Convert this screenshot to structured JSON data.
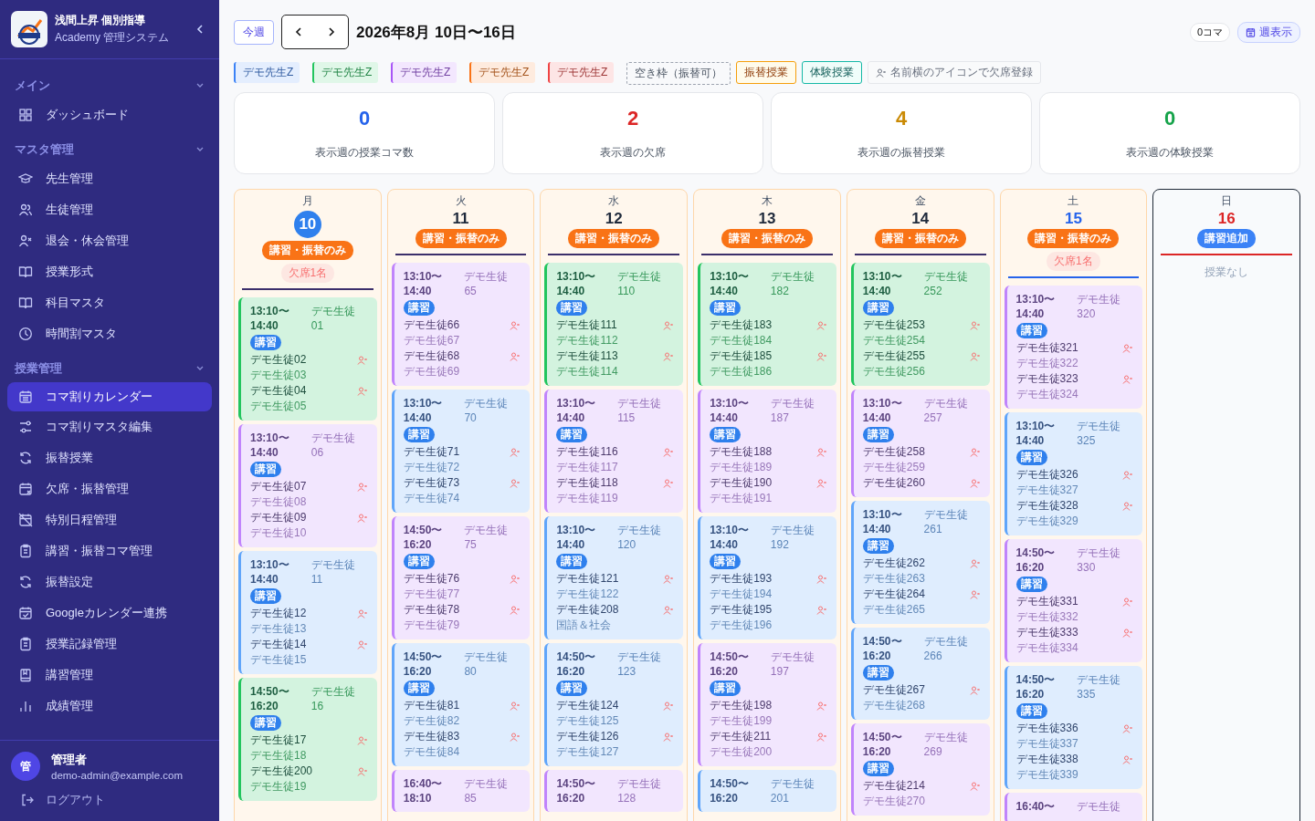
{
  "sidebar": {
    "brand": {
      "title": "浅間上昇 個別指導",
      "subtitle": "Academy 管理システム"
    },
    "sections": [
      {
        "title": "メイン",
        "expanded": true,
        "items": [
          {
            "label": "ダッシュボード",
            "selected": false
          }
        ]
      },
      {
        "title": "マスタ管理",
        "expanded": true,
        "items": [
          {
            "label": "先生管理",
            "selected": false
          },
          {
            "label": "生徒管理",
            "selected": false
          },
          {
            "label": "退会・休会管理",
            "selected": false
          },
          {
            "label": "授業形式",
            "selected": false
          },
          {
            "label": "科目マスタ",
            "selected": false
          },
          {
            "label": "時間割マスタ",
            "selected": false
          }
        ]
      },
      {
        "title": "授業管理",
        "expanded": true,
        "items": [
          {
            "label": "コマ割りカレンダー",
            "selected": true
          },
          {
            "label": "コマ割りマスタ編集",
            "selected": false
          },
          {
            "label": "振替授業",
            "selected": false
          },
          {
            "label": "欠席・振替管理",
            "selected": false
          },
          {
            "label": "特別日程管理",
            "selected": false
          },
          {
            "label": "講習・振替コマ管理",
            "selected": false
          },
          {
            "label": "振替設定",
            "selected": false
          },
          {
            "label": "Googleカレンダー連携",
            "selected": false
          },
          {
            "label": "授業記録管理",
            "selected": false
          },
          {
            "label": "講習管理",
            "selected": false
          },
          {
            "label": "成績管理",
            "selected": false
          }
        ]
      }
    ],
    "user": {
      "avatar": "管",
      "name": "管理者",
      "email": "demo-admin@example.com"
    },
    "logout": "ログアウト"
  },
  "toolbar": {
    "today_button": "今週",
    "title": "2026年8月 10日〜16日",
    "count": "0コマ",
    "view_button": "週表示"
  },
  "legend": [
    {
      "kind": "teacher",
      "label": "デモ先生Z",
      "color": "#3b82f6"
    },
    {
      "kind": "teacher",
      "label": "デモ先生Z",
      "color": "#22c55e"
    },
    {
      "kind": "teacher",
      "label": "デモ先生Z",
      "color": "#a855f7"
    },
    {
      "kind": "teacher",
      "label": "デモ先生Z",
      "color": "#f97316"
    },
    {
      "kind": "teacher",
      "label": "デモ先生Z",
      "color": "#ef4444"
    },
    {
      "kind": "empty",
      "label": "空き枠（振替可）"
    },
    {
      "kind": "transfer",
      "label": "振替授業"
    },
    {
      "kind": "trial",
      "label": "体験授業"
    },
    {
      "kind": "hint",
      "label": "名前横のアイコンで欠席登録"
    }
  ],
  "stats": [
    {
      "value": "0",
      "label": "表示週の授業コマ数",
      "color": "#2563eb"
    },
    {
      "value": "2",
      "label": "表示週の欠席",
      "color": "#dc2626"
    },
    {
      "value": "4",
      "label": "表示週の振替授業",
      "color": "#ca8a04"
    },
    {
      "value": "0",
      "label": "表示週の体験授業",
      "color": "#16a34a"
    }
  ],
  "days": [
    {
      "weekday": "月",
      "date": "10",
      "kind": "weekday",
      "today": true,
      "selected": false,
      "badge": {
        "kind": "restricted",
        "label": "講習・振替のみ"
      },
      "absence": "欠席1名",
      "lessons": [
        {
          "color": "#22c55e",
          "start": "13:10〜",
          "end": "14:40",
          "teacher": "デモ生徒01",
          "tag": "講習",
          "students": [
            {
              "name": "デモ生徒02",
              "kind": "main"
            },
            {
              "name": "デモ生徒03",
              "kind": "sub"
            },
            {
              "name": "デモ生徒04",
              "kind": "main"
            },
            {
              "name": "デモ生徒05",
              "kind": "sub"
            }
          ]
        },
        {
          "color": "#c084fc",
          "start": "13:10〜",
          "end": "14:40",
          "teacher": "デモ生徒06",
          "tag": "講習",
          "students": [
            {
              "name": "デモ生徒07",
              "kind": "main"
            },
            {
              "name": "デモ生徒08",
              "kind": "sub"
            },
            {
              "name": "デモ生徒09",
              "kind": "main"
            },
            {
              "name": "デモ生徒10",
              "kind": "sub"
            }
          ]
        },
        {
          "color": "#60a5fa",
          "start": "13:10〜",
          "end": "14:40",
          "teacher": "デモ生徒11",
          "tag": "講習",
          "students": [
            {
              "name": "デモ生徒12",
              "kind": "main"
            },
            {
              "name": "デモ生徒13",
              "kind": "sub"
            },
            {
              "name": "デモ生徒14",
              "kind": "main"
            },
            {
              "name": "デモ生徒15",
              "kind": "sub"
            }
          ]
        },
        {
          "color": "#22c55e",
          "start": "14:50〜",
          "end": "16:20",
          "teacher": "デモ生徒16",
          "tag": "講習",
          "students": [
            {
              "name": "デモ生徒17",
              "kind": "main"
            },
            {
              "name": "デモ生徒18",
              "kind": "sub"
            },
            {
              "name": "デモ生徒200",
              "kind": "main"
            },
            {
              "name": "デモ生徒19",
              "kind": "sub"
            }
          ]
        }
      ]
    },
    {
      "weekday": "火",
      "date": "11",
      "kind": "weekday",
      "today": false,
      "selected": false,
      "badge": {
        "kind": "restricted",
        "label": "講習・振替のみ"
      },
      "lessons": [
        {
          "color": "#c084fc",
          "start": "13:10〜",
          "end": "14:40",
          "teacher": "デモ生徒65",
          "tag": "講習",
          "students": [
            {
              "name": "デモ生徒66",
              "kind": "main"
            },
            {
              "name": "デモ生徒67",
              "kind": "sub"
            },
            {
              "name": "デモ生徒68",
              "kind": "main"
            },
            {
              "name": "デモ生徒69",
              "kind": "sub"
            }
          ]
        },
        {
          "color": "#60a5fa",
          "start": "13:10〜",
          "end": "14:40",
          "teacher": "デモ生徒70",
          "tag": "講習",
          "students": [
            {
              "name": "デモ生徒71",
              "kind": "main"
            },
            {
              "name": "デモ生徒72",
              "kind": "sub"
            },
            {
              "name": "デモ生徒73",
              "kind": "main"
            },
            {
              "name": "デモ生徒74",
              "kind": "sub"
            }
          ]
        },
        {
          "color": "#c084fc",
          "start": "14:50〜",
          "end": "16:20",
          "teacher": "デモ生徒75",
          "tag": "講習",
          "students": [
            {
              "name": "デモ生徒76",
              "kind": "main"
            },
            {
              "name": "デモ生徒77",
              "kind": "sub"
            },
            {
              "name": "デモ生徒78",
              "kind": "main"
            },
            {
              "name": "デモ生徒79",
              "kind": "sub"
            }
          ]
        },
        {
          "color": "#60a5fa",
          "start": "14:50〜",
          "end": "16:20",
          "teacher": "デモ生徒80",
          "tag": "講習",
          "students": [
            {
              "name": "デモ生徒81",
              "kind": "main"
            },
            {
              "name": "デモ生徒82",
              "kind": "sub"
            },
            {
              "name": "デモ生徒83",
              "kind": "main"
            },
            {
              "name": "デモ生徒84",
              "kind": "sub"
            }
          ]
        },
        {
          "color": "#c084fc",
          "start": "16:40〜",
          "end": "18:10",
          "teacher": "デモ生徒85"
        }
      ]
    },
    {
      "weekday": "水",
      "date": "12",
      "kind": "weekday",
      "today": false,
      "selected": false,
      "badge": {
        "kind": "restricted",
        "label": "講習・振替のみ"
      },
      "lessons": [
        {
          "color": "#22c55e",
          "start": "13:10〜",
          "end": "14:40",
          "teacher": "デモ生徒110",
          "tag": "講習",
          "students": [
            {
              "name": "デモ生徒111",
              "kind": "main"
            },
            {
              "name": "デモ生徒112",
              "kind": "sub"
            },
            {
              "name": "デモ生徒113",
              "kind": "main"
            },
            {
              "name": "デモ生徒114",
              "kind": "sub"
            }
          ]
        },
        {
          "color": "#c084fc",
          "start": "13:10〜",
          "end": "14:40",
          "teacher": "デモ生徒115",
          "tag": "講習",
          "students": [
            {
              "name": "デモ生徒116",
              "kind": "main"
            },
            {
              "name": "デモ生徒117",
              "kind": "sub"
            },
            {
              "name": "デモ生徒118",
              "kind": "main"
            },
            {
              "name": "デモ生徒119",
              "kind": "sub"
            }
          ]
        },
        {
          "color": "#60a5fa",
          "start": "13:10〜",
          "end": "14:40",
          "teacher": "デモ生徒120",
          "tag": "講習",
          "students": [
            {
              "name": "デモ生徒121",
              "kind": "main"
            },
            {
              "name": "デモ生徒122",
              "kind": "sub"
            },
            {
              "name": "デモ生徒208",
              "kind": "main"
            },
            {
              "name": "国語＆社会",
              "kind": "sub"
            }
          ]
        },
        {
          "color": "#60a5fa",
          "start": "14:50〜",
          "end": "16:20",
          "teacher": "デモ生徒123",
          "tag": "講習",
          "students": [
            {
              "name": "デモ生徒124",
              "kind": "main"
            },
            {
              "name": "デモ生徒125",
              "kind": "sub"
            },
            {
              "name": "デモ生徒126",
              "kind": "main"
            },
            {
              "name": "デモ生徒127",
              "kind": "sub"
            }
          ]
        },
        {
          "color": "#c084fc",
          "start": "14:50〜",
          "end": "16:20",
          "teacher": "デモ生徒128"
        }
      ]
    },
    {
      "weekday": "木",
      "date": "13",
      "kind": "weekday",
      "today": false,
      "selected": false,
      "badge": {
        "kind": "restricted",
        "label": "講習・振替のみ"
      },
      "lessons": [
        {
          "color": "#22c55e",
          "start": "13:10〜",
          "end": "14:40",
          "teacher": "デモ生徒182",
          "tag": "講習",
          "students": [
            {
              "name": "デモ生徒183",
              "kind": "main"
            },
            {
              "name": "デモ生徒184",
              "kind": "sub"
            },
            {
              "name": "デモ生徒185",
              "kind": "main"
            },
            {
              "name": "デモ生徒186",
              "kind": "sub"
            }
          ]
        },
        {
          "color": "#c084fc",
          "start": "13:10〜",
          "end": "14:40",
          "teacher": "デモ生徒187",
          "tag": "講習",
          "students": [
            {
              "name": "デモ生徒188",
              "kind": "main"
            },
            {
              "name": "デモ生徒189",
              "kind": "sub"
            },
            {
              "name": "デモ生徒190",
              "kind": "main"
            },
            {
              "name": "デモ生徒191",
              "kind": "sub"
            }
          ]
        },
        {
          "color": "#60a5fa",
          "start": "13:10〜",
          "end": "14:40",
          "teacher": "デモ生徒192",
          "tag": "講習",
          "students": [
            {
              "name": "デモ生徒193",
              "kind": "main"
            },
            {
              "name": "デモ生徒194",
              "kind": "sub"
            },
            {
              "name": "デモ生徒195",
              "kind": "main"
            },
            {
              "name": "デモ生徒196",
              "kind": "sub"
            }
          ]
        },
        {
          "color": "#c084fc",
          "start": "14:50〜",
          "end": "16:20",
          "teacher": "デモ生徒197",
          "tag": "講習",
          "students": [
            {
              "name": "デモ生徒198",
              "kind": "main"
            },
            {
              "name": "デモ生徒199",
              "kind": "sub"
            },
            {
              "name": "デモ生徒211",
              "kind": "main"
            },
            {
              "name": "デモ生徒200",
              "kind": "sub"
            }
          ]
        },
        {
          "color": "#60a5fa",
          "start": "14:50〜",
          "end": "16:20",
          "teacher": "デモ生徒201"
        }
      ]
    },
    {
      "weekday": "金",
      "date": "14",
      "kind": "weekday",
      "today": false,
      "selected": false,
      "badge": {
        "kind": "restricted",
        "label": "講習・振替のみ"
      },
      "lessons": [
        {
          "color": "#22c55e",
          "start": "13:10〜",
          "end": "14:40",
          "teacher": "デモ生徒252",
          "tag": "講習",
          "students": [
            {
              "name": "デモ生徒253",
              "kind": "main"
            },
            {
              "name": "デモ生徒254",
              "kind": "sub"
            },
            {
              "name": "デモ生徒255",
              "kind": "main"
            },
            {
              "name": "デモ生徒256",
              "kind": "sub"
            }
          ]
        },
        {
          "color": "#c084fc",
          "start": "13:10〜",
          "end": "14:40",
          "teacher": "デモ生徒257",
          "tag": "講習",
          "students": [
            {
              "name": "デモ生徒258",
              "kind": "main"
            },
            {
              "name": "デモ生徒259",
              "kind": "sub"
            },
            {
              "name": "デモ生徒260",
              "kind": "main"
            }
          ]
        },
        {
          "color": "#60a5fa",
          "start": "13:10〜",
          "end": "14:40",
          "teacher": "デモ生徒261",
          "tag": "講習",
          "students": [
            {
              "name": "デモ生徒262",
              "kind": "main"
            },
            {
              "name": "デモ生徒263",
              "kind": "sub"
            },
            {
              "name": "デモ生徒264",
              "kind": "main"
            },
            {
              "name": "デモ生徒265",
              "kind": "sub"
            }
          ]
        },
        {
          "color": "#60a5fa",
          "start": "14:50〜",
          "end": "16:20",
          "teacher": "デモ生徒266",
          "tag": "講習",
          "students": [
            {
              "name": "デモ生徒267",
              "kind": "main"
            },
            {
              "name": "デモ生徒268",
              "kind": "sub"
            }
          ]
        },
        {
          "color": "#c084fc",
          "start": "14:50〜",
          "end": "16:20",
          "teacher": "デモ生徒269",
          "tag": "講習",
          "students": [
            {
              "name": "デモ生徒214",
              "kind": "main"
            },
            {
              "name": "デモ生徒270",
              "kind": "sub"
            }
          ]
        }
      ]
    },
    {
      "weekday": "土",
      "date": "15",
      "kind": "saturday",
      "today": false,
      "selected": false,
      "badge": {
        "kind": "restricted",
        "label": "講習・振替のみ"
      },
      "absence": "欠席1名",
      "lessons": [
        {
          "color": "#c084fc",
          "start": "13:10〜",
          "end": "14:40",
          "teacher": "デモ生徒320",
          "tag": "講習",
          "students": [
            {
              "name": "デモ生徒321",
              "kind": "main"
            },
            {
              "name": "デモ生徒322",
              "kind": "sub"
            },
            {
              "name": "デモ生徒323",
              "kind": "main"
            },
            {
              "name": "デモ生徒324",
              "kind": "sub"
            }
          ]
        },
        {
          "color": "#60a5fa",
          "start": "13:10〜",
          "end": "14:40",
          "teacher": "デモ生徒325",
          "tag": "講習",
          "students": [
            {
              "name": "デモ生徒326",
              "kind": "main"
            },
            {
              "name": "デモ生徒327",
              "kind": "sub"
            },
            {
              "name": "デモ生徒328",
              "kind": "main"
            },
            {
              "name": "デモ生徒329",
              "kind": "sub"
            }
          ]
        },
        {
          "color": "#c084fc",
          "start": "14:50〜",
          "end": "16:20",
          "teacher": "デモ生徒330",
          "tag": "講習",
          "students": [
            {
              "name": "デモ生徒331",
              "kind": "main"
            },
            {
              "name": "デモ生徒332",
              "kind": "sub"
            },
            {
              "name": "デモ生徒333",
              "kind": "main"
            },
            {
              "name": "デモ生徒334",
              "kind": "sub"
            }
          ]
        },
        {
          "color": "#60a5fa",
          "start": "14:50〜",
          "end": "16:20",
          "teacher": "デモ生徒335",
          "tag": "講習",
          "students": [
            {
              "name": "デモ生徒336",
              "kind": "main"
            },
            {
              "name": "デモ生徒337",
              "kind": "sub"
            },
            {
              "name": "デモ生徒338",
              "kind": "main"
            },
            {
              "name": "デモ生徒339",
              "kind": "sub"
            }
          ]
        },
        {
          "color": "#c084fc",
          "start": "16:40〜",
          "teacher": "デモ生徒"
        }
      ]
    },
    {
      "weekday": "日",
      "date": "16",
      "kind": "sunday",
      "today": false,
      "selected": true,
      "badge": {
        "kind": "extra",
        "label": "講習追加"
      },
      "empty": "授業なし"
    }
  ]
}
